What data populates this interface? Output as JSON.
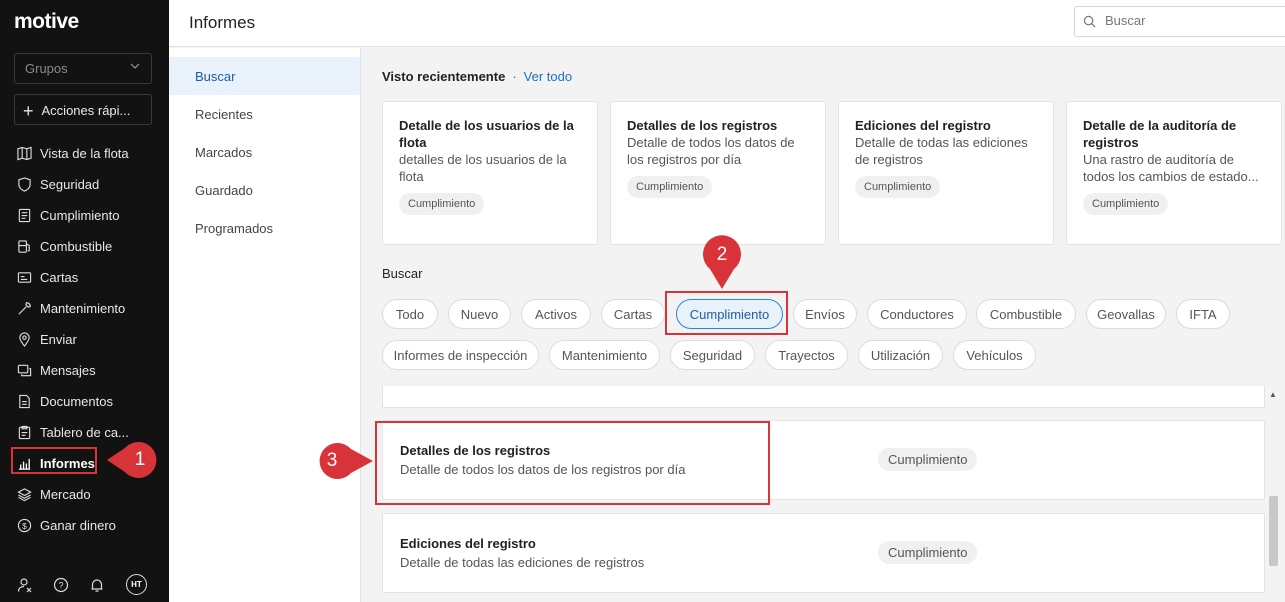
{
  "sidebar": {
    "logo": "motive",
    "groups_placeholder": "Grupos",
    "quick_actions": "Acciones rápi...",
    "items": [
      {
        "label": "Vista de la flota",
        "icon": "map-icon"
      },
      {
        "label": "Seguridad",
        "icon": "shield-icon"
      },
      {
        "label": "Cumplimiento",
        "icon": "document-list-icon"
      },
      {
        "label": "Combustible",
        "icon": "fuel-pump-icon"
      },
      {
        "label": "Cartas",
        "icon": "id-card-icon"
      },
      {
        "label": "Mantenimiento",
        "icon": "wrench-icon"
      },
      {
        "label": "Enviar",
        "icon": "location-pin-icon"
      },
      {
        "label": "Mensajes",
        "icon": "messages-icon"
      },
      {
        "label": "Documentos",
        "icon": "documents-icon"
      },
      {
        "label": "Tablero de ca...",
        "icon": "clipboard-icon"
      },
      {
        "label": "Informes",
        "icon": "bar-chart-icon",
        "active": true
      },
      {
        "label": "Mercado",
        "icon": "layers-icon"
      },
      {
        "label": "Ganar dinero",
        "icon": "dollar-circle-icon"
      }
    ],
    "avatar_initials": "HT"
  },
  "header": {
    "title": "Informes",
    "search_placeholder": "Buscar"
  },
  "subnav": {
    "items": [
      "Buscar",
      "Recientes",
      "Marcados",
      "Guardado",
      "Programados"
    ],
    "active_index": 0
  },
  "recent": {
    "title": "Visto recientemente",
    "separator": "·",
    "view_all": "Ver todo",
    "cards": [
      {
        "title": "Detalle de los usuarios de la flota",
        "description": "detalles de los usuarios de la flota",
        "badge": "Cumplimiento"
      },
      {
        "title": "Detalles de los registros",
        "description": "Detalle de todos los datos de los registros por día",
        "badge": "Cumplimiento"
      },
      {
        "title": "Ediciones del registro",
        "description": "Detalle de todas las ediciones de registros",
        "badge": "Cumplimiento"
      },
      {
        "title": "Detalle de la auditoría de registros",
        "description": "Una rastro de auditoría de todos los cambios de estado...",
        "badge": "Cumplimiento"
      }
    ]
  },
  "search_section": {
    "label": "Buscar",
    "chips": [
      "Todo",
      "Nuevo",
      "Activos",
      "Cartas",
      "Cumplimiento",
      "Envíos",
      "Conductores",
      "Combustible",
      "Geovallas",
      "IFTA",
      "Informes de inspección",
      "Mantenimiento",
      "Seguridad",
      "Trayectos",
      "Utilización",
      "Vehículos"
    ],
    "selected_chip": "Cumplimiento"
  },
  "results": [
    {
      "title": "Detalles de los registros",
      "description": "Detalle de todos los datos de los registros por día",
      "badge": "Cumplimiento"
    },
    {
      "title": "Ediciones del registro",
      "description": "Detalle de todas las ediciones de registros",
      "badge": "Cumplimiento"
    }
  ],
  "callouts": [
    "1",
    "2",
    "3"
  ],
  "colors": {
    "sidebar_bg": "#121212",
    "accent": "#1f6fc5",
    "annotation_red": "#d9333a",
    "selected_chip_bg": "#e8f2fb"
  }
}
